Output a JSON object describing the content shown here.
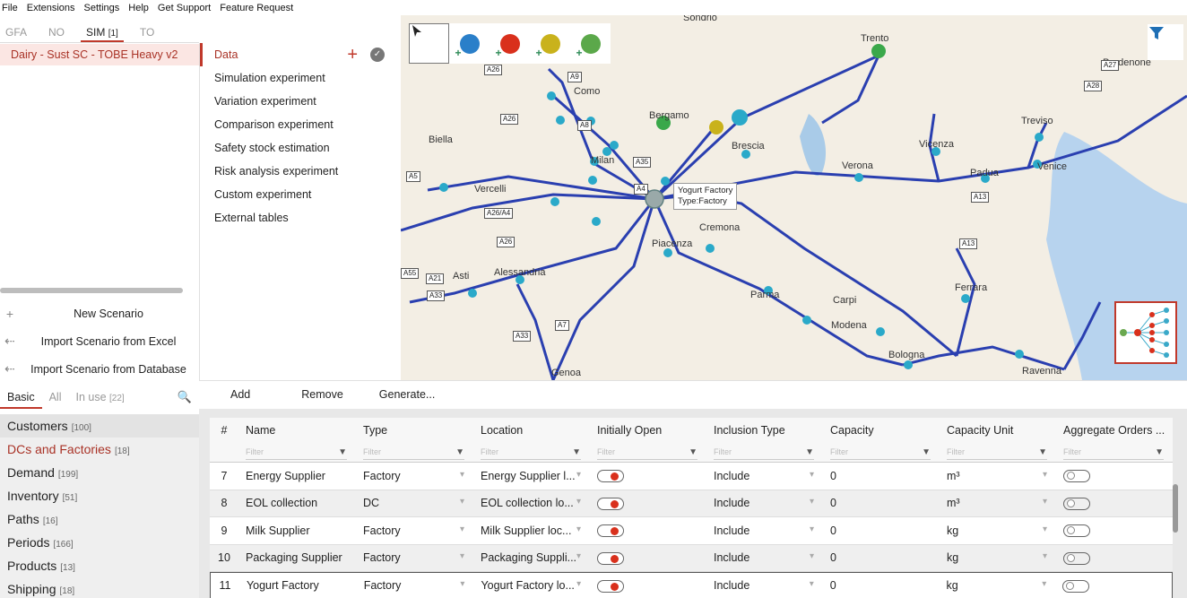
{
  "menu": [
    "File",
    "Extensions",
    "Settings",
    "Help",
    "Get Support",
    "Feature Request"
  ],
  "mode_tabs": [
    {
      "label": "GFA",
      "count": ""
    },
    {
      "label": "NO",
      "count": ""
    },
    {
      "label": "SIM",
      "count": "[1]"
    },
    {
      "label": "TO",
      "count": ""
    }
  ],
  "scenario": "Dairy - Sust SC - TOBE Heavy v2",
  "experiments": [
    "Data",
    "Simulation experiment",
    "Variation experiment",
    "Comparison experiment",
    "Safety stock estimation",
    "Risk analysis experiment",
    "Custom experiment",
    "External tables"
  ],
  "scenario_actions": [
    "New Scenario",
    "Import Scenario from Excel",
    "Import Scenario from Database"
  ],
  "map": {
    "tooltip_title": "Yogurt Factory",
    "tooltip_type": "Type:Factory",
    "cities": [
      {
        "name": "Sondrio"
      },
      {
        "name": "Trento"
      },
      {
        "name": "Pordenone"
      },
      {
        "name": "Como"
      },
      {
        "name": "Bergamo"
      },
      {
        "name": "Biella"
      },
      {
        "name": "Brescia"
      },
      {
        "name": "Milan"
      },
      {
        "name": "Vicenza"
      },
      {
        "name": "Treviso"
      },
      {
        "name": "Verona"
      },
      {
        "name": "Padua"
      },
      {
        "name": "Venice"
      },
      {
        "name": "Vercelli"
      },
      {
        "name": "Cremona"
      },
      {
        "name": "Piacenza"
      },
      {
        "name": "Alessandria"
      },
      {
        "name": "Asti"
      },
      {
        "name": "Ferrara"
      },
      {
        "name": "Carpi"
      },
      {
        "name": "Parma"
      },
      {
        "name": "Modena"
      },
      {
        "name": "Bologna"
      },
      {
        "name": "Genoa"
      },
      {
        "name": "Ravenna"
      }
    ],
    "highways": [
      "A26",
      "A9",
      "A27",
      "A28",
      "A26",
      "A8",
      "A5",
      "A35",
      "A4",
      "A26/A4",
      "A26",
      "A13",
      "A21",
      "A33",
      "A7",
      "A33",
      "A13",
      "A55"
    ]
  },
  "category_tabs": [
    {
      "label": "Basic",
      "count": ""
    },
    {
      "label": "All",
      "count": ""
    },
    {
      "label": "In use",
      "count": "[22]"
    }
  ],
  "categories": [
    {
      "label": "Customers",
      "count": "[100]"
    },
    {
      "label": "DCs and Factories",
      "count": "[18]"
    },
    {
      "label": "Demand",
      "count": "[199]"
    },
    {
      "label": "Inventory",
      "count": "[51]"
    },
    {
      "label": "Paths",
      "count": "[16]"
    },
    {
      "label": "Periods",
      "count": "[166]"
    },
    {
      "label": "Products",
      "count": "[13]"
    },
    {
      "label": "Shipping",
      "count": "[18]"
    }
  ],
  "toolbar": {
    "add": "Add",
    "remove": "Remove",
    "generate": "Generate..."
  },
  "table": {
    "headers": [
      "#",
      "Name",
      "Type",
      "Location",
      "Initially Open",
      "Inclusion Type",
      "Capacity",
      "Capacity Unit",
      "Aggregate Orders ..."
    ],
    "filter_placeholder": "Filter",
    "rows": [
      {
        "n": "7",
        "name": "Energy Supplier",
        "type": "Factory",
        "location": "Energy Supplier l...",
        "open": true,
        "inclusion": "Include",
        "capacity": "0",
        "unit": "m³",
        "agg": false
      },
      {
        "n": "8",
        "name": "EOL collection",
        "type": "DC",
        "location": "EOL collection lo...",
        "open": true,
        "inclusion": "Include",
        "capacity": "0",
        "unit": "m³",
        "agg": false
      },
      {
        "n": "9",
        "name": "Milk Supplier",
        "type": "Factory",
        "location": "Milk Supplier loc...",
        "open": true,
        "inclusion": "Include",
        "capacity": "0",
        "unit": "kg",
        "agg": false
      },
      {
        "n": "10",
        "name": "Packaging Supplier",
        "type": "Factory",
        "location": "Packaging Suppli...",
        "open": true,
        "inclusion": "Include",
        "capacity": "0",
        "unit": "kg",
        "agg": false
      },
      {
        "n": "11",
        "name": "Yogurt Factory",
        "type": "Factory",
        "location": "Yogurt Factory lo...",
        "open": true,
        "inclusion": "Include",
        "capacity": "0",
        "unit": "kg",
        "agg": false
      }
    ]
  },
  "colors": {
    "accent": "#c0392b",
    "road": "#2a3fb0",
    "node": "#2aa9c9"
  }
}
